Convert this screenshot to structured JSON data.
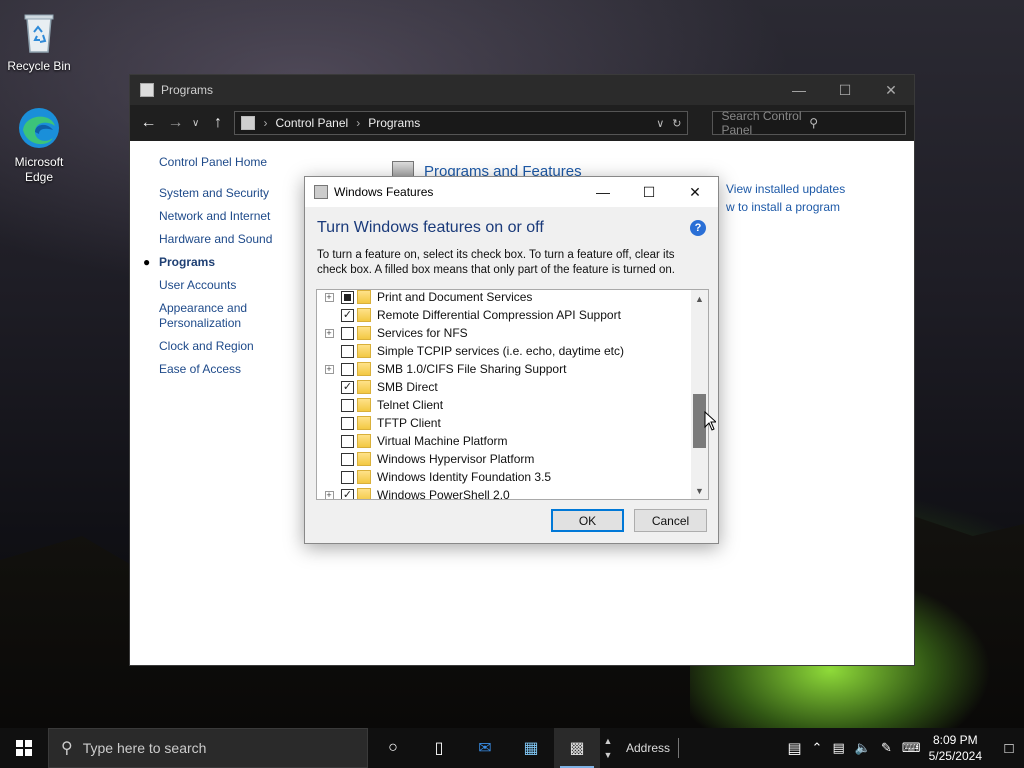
{
  "desktop": {
    "icons": [
      {
        "label": "Recycle Bin"
      },
      {
        "label_line1": "Microsoft",
        "label_line2": "Edge"
      }
    ]
  },
  "explorer": {
    "title": "Programs",
    "address": {
      "crumb1": "Control Panel",
      "crumb2": "Programs"
    },
    "search_placeholder": "Search Control Panel",
    "leftnav": {
      "home": "Control Panel Home",
      "items": [
        {
          "label": "System and Security"
        },
        {
          "label": "Network and Internet"
        },
        {
          "label": "Hardware and Sound"
        },
        {
          "label": "Programs",
          "active": true
        },
        {
          "label": "User Accounts"
        },
        {
          "label_line1": "Appearance and",
          "label_line2": "Personalization"
        },
        {
          "label": "Clock and Region"
        },
        {
          "label": "Ease of Access"
        }
      ]
    },
    "content": {
      "heading": "Programs and Features",
      "link1": "View installed updates",
      "link2": "w to install a program"
    }
  },
  "dialog": {
    "title": "Windows Features",
    "heading": "Turn Windows features on or off",
    "help": "?",
    "description": "To turn a feature on, select its check box. To turn a feature off, clear its check box. A filled box means that only part of the feature is turned on.",
    "features": [
      {
        "label": "Print and Document Services",
        "state": "partial",
        "expandable": true
      },
      {
        "label": "Remote Differential Compression API Support",
        "state": "checked",
        "expandable": false
      },
      {
        "label": "Services for NFS",
        "state": "unchecked",
        "expandable": true
      },
      {
        "label": "Simple TCPIP services (i.e. echo, daytime etc)",
        "state": "unchecked",
        "expandable": false
      },
      {
        "label": "SMB 1.0/CIFS File Sharing Support",
        "state": "unchecked",
        "expandable": true
      },
      {
        "label": "SMB Direct",
        "state": "checked",
        "expandable": false
      },
      {
        "label": "Telnet Client",
        "state": "unchecked",
        "expandable": false
      },
      {
        "label": "TFTP Client",
        "state": "unchecked",
        "expandable": false
      },
      {
        "label": "Virtual Machine Platform",
        "state": "unchecked",
        "expandable": false
      },
      {
        "label": "Windows Hypervisor Platform",
        "state": "unchecked",
        "expandable": false
      },
      {
        "label": "Windows Identity Foundation 3.5",
        "state": "unchecked",
        "expandable": false
      },
      {
        "label": "Windows PowerShell 2.0",
        "state": "checked",
        "expandable": true
      }
    ],
    "ok": "OK",
    "cancel": "Cancel"
  },
  "taskbar": {
    "search_placeholder": "Type here to search",
    "address_label": "Address",
    "time": "8:09 PM",
    "date": "5/25/2024"
  },
  "colors": {
    "link": "#1e4a8a",
    "heading": "#1a3a7a",
    "accent": "#0078d7"
  }
}
